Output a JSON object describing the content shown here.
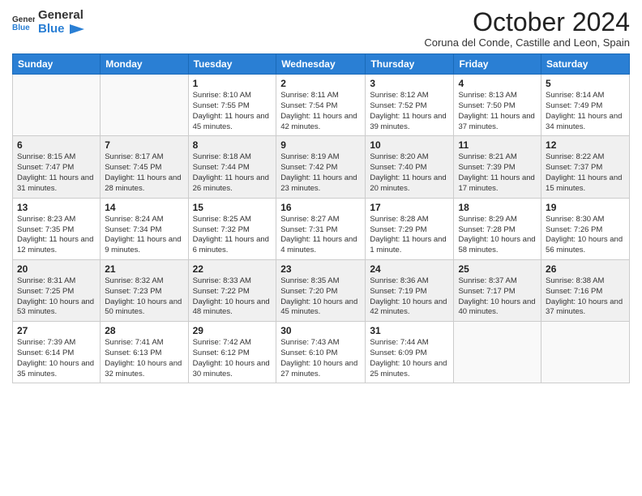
{
  "header": {
    "logo_general": "General",
    "logo_blue": "Blue",
    "month_title": "October 2024",
    "subtitle": "Coruna del Conde, Castille and Leon, Spain"
  },
  "columns": [
    "Sunday",
    "Monday",
    "Tuesday",
    "Wednesday",
    "Thursday",
    "Friday",
    "Saturday"
  ],
  "weeks": [
    [
      {
        "day": "",
        "info": ""
      },
      {
        "day": "",
        "info": ""
      },
      {
        "day": "1",
        "info": "Sunrise: 8:10 AM\nSunset: 7:55 PM\nDaylight: 11 hours and 45 minutes."
      },
      {
        "day": "2",
        "info": "Sunrise: 8:11 AM\nSunset: 7:54 PM\nDaylight: 11 hours and 42 minutes."
      },
      {
        "day": "3",
        "info": "Sunrise: 8:12 AM\nSunset: 7:52 PM\nDaylight: 11 hours and 39 minutes."
      },
      {
        "day": "4",
        "info": "Sunrise: 8:13 AM\nSunset: 7:50 PM\nDaylight: 11 hours and 37 minutes."
      },
      {
        "day": "5",
        "info": "Sunrise: 8:14 AM\nSunset: 7:49 PM\nDaylight: 11 hours and 34 minutes."
      }
    ],
    [
      {
        "day": "6",
        "info": "Sunrise: 8:15 AM\nSunset: 7:47 PM\nDaylight: 11 hours and 31 minutes."
      },
      {
        "day": "7",
        "info": "Sunrise: 8:17 AM\nSunset: 7:45 PM\nDaylight: 11 hours and 28 minutes."
      },
      {
        "day": "8",
        "info": "Sunrise: 8:18 AM\nSunset: 7:44 PM\nDaylight: 11 hours and 26 minutes."
      },
      {
        "day": "9",
        "info": "Sunrise: 8:19 AM\nSunset: 7:42 PM\nDaylight: 11 hours and 23 minutes."
      },
      {
        "day": "10",
        "info": "Sunrise: 8:20 AM\nSunset: 7:40 PM\nDaylight: 11 hours and 20 minutes."
      },
      {
        "day": "11",
        "info": "Sunrise: 8:21 AM\nSunset: 7:39 PM\nDaylight: 11 hours and 17 minutes."
      },
      {
        "day": "12",
        "info": "Sunrise: 8:22 AM\nSunset: 7:37 PM\nDaylight: 11 hours and 15 minutes."
      }
    ],
    [
      {
        "day": "13",
        "info": "Sunrise: 8:23 AM\nSunset: 7:35 PM\nDaylight: 11 hours and 12 minutes."
      },
      {
        "day": "14",
        "info": "Sunrise: 8:24 AM\nSunset: 7:34 PM\nDaylight: 11 hours and 9 minutes."
      },
      {
        "day": "15",
        "info": "Sunrise: 8:25 AM\nSunset: 7:32 PM\nDaylight: 11 hours and 6 minutes."
      },
      {
        "day": "16",
        "info": "Sunrise: 8:27 AM\nSunset: 7:31 PM\nDaylight: 11 hours and 4 minutes."
      },
      {
        "day": "17",
        "info": "Sunrise: 8:28 AM\nSunset: 7:29 PM\nDaylight: 11 hours and 1 minute."
      },
      {
        "day": "18",
        "info": "Sunrise: 8:29 AM\nSunset: 7:28 PM\nDaylight: 10 hours and 58 minutes."
      },
      {
        "day": "19",
        "info": "Sunrise: 8:30 AM\nSunset: 7:26 PM\nDaylight: 10 hours and 56 minutes."
      }
    ],
    [
      {
        "day": "20",
        "info": "Sunrise: 8:31 AM\nSunset: 7:25 PM\nDaylight: 10 hours and 53 minutes."
      },
      {
        "day": "21",
        "info": "Sunrise: 8:32 AM\nSunset: 7:23 PM\nDaylight: 10 hours and 50 minutes."
      },
      {
        "day": "22",
        "info": "Sunrise: 8:33 AM\nSunset: 7:22 PM\nDaylight: 10 hours and 48 minutes."
      },
      {
        "day": "23",
        "info": "Sunrise: 8:35 AM\nSunset: 7:20 PM\nDaylight: 10 hours and 45 minutes."
      },
      {
        "day": "24",
        "info": "Sunrise: 8:36 AM\nSunset: 7:19 PM\nDaylight: 10 hours and 42 minutes."
      },
      {
        "day": "25",
        "info": "Sunrise: 8:37 AM\nSunset: 7:17 PM\nDaylight: 10 hours and 40 minutes."
      },
      {
        "day": "26",
        "info": "Sunrise: 8:38 AM\nSunset: 7:16 PM\nDaylight: 10 hours and 37 minutes."
      }
    ],
    [
      {
        "day": "27",
        "info": "Sunrise: 7:39 AM\nSunset: 6:14 PM\nDaylight: 10 hours and 35 minutes."
      },
      {
        "day": "28",
        "info": "Sunrise: 7:41 AM\nSunset: 6:13 PM\nDaylight: 10 hours and 32 minutes."
      },
      {
        "day": "29",
        "info": "Sunrise: 7:42 AM\nSunset: 6:12 PM\nDaylight: 10 hours and 30 minutes."
      },
      {
        "day": "30",
        "info": "Sunrise: 7:43 AM\nSunset: 6:10 PM\nDaylight: 10 hours and 27 minutes."
      },
      {
        "day": "31",
        "info": "Sunrise: 7:44 AM\nSunset: 6:09 PM\nDaylight: 10 hours and 25 minutes."
      },
      {
        "day": "",
        "info": ""
      },
      {
        "day": "",
        "info": ""
      }
    ]
  ]
}
